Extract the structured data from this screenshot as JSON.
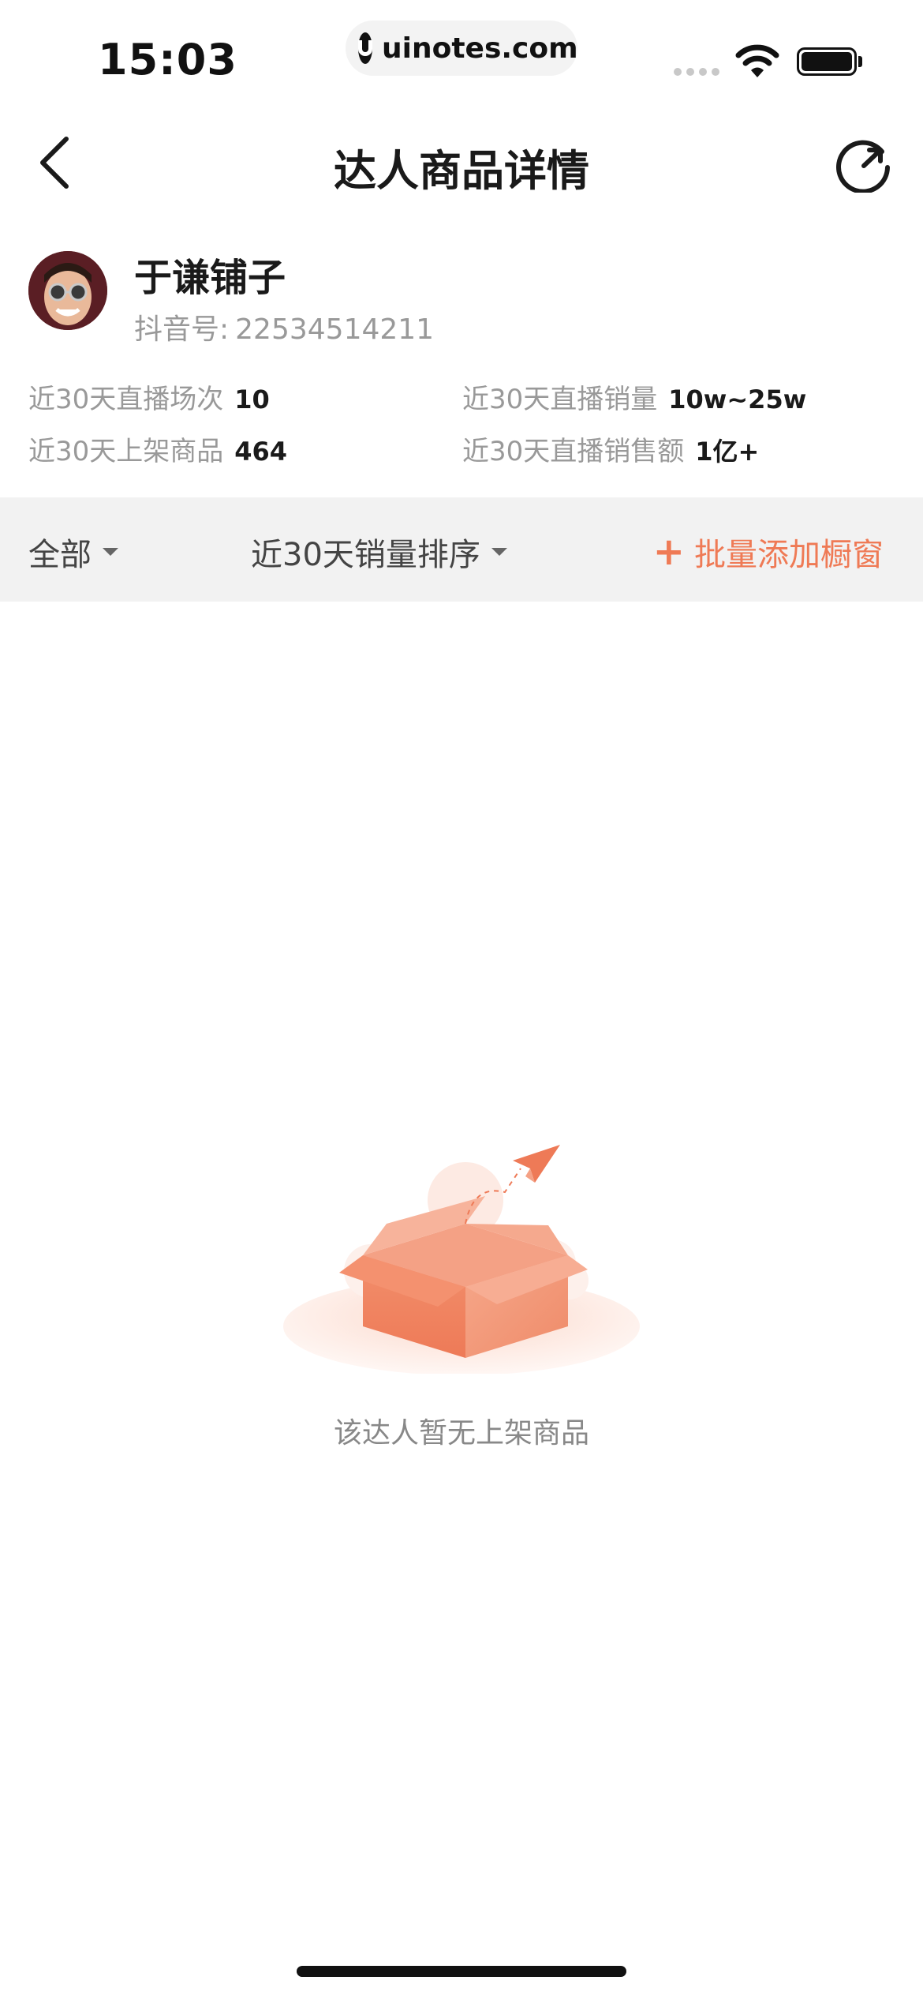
{
  "status_bar": {
    "time": "15:03",
    "url": "uinotes.com"
  },
  "nav": {
    "title": "达人商品详情"
  },
  "profile": {
    "name": "于谦铺子",
    "account_label": "抖音号:",
    "account_number": "22534514211"
  },
  "stats": [
    {
      "label": "近30天直播场次",
      "value": "10"
    },
    {
      "label": "近30天直播销量",
      "value": "10w~25w"
    },
    {
      "label": "近30天上架商品",
      "value": "464"
    },
    {
      "label": "近30天直播销售额",
      "value": "1亿+"
    }
  ],
  "filters": {
    "category": "全部",
    "sort": "近30天销量排序",
    "batch_add": "批量添加橱窗",
    "batch_add_icon": "+"
  },
  "empty_state": {
    "message": "该达人暂无上架商品"
  },
  "colors": {
    "accent": "#ef7a55",
    "filter_bg": "#f2f2f2",
    "muted_text": "#999999"
  }
}
